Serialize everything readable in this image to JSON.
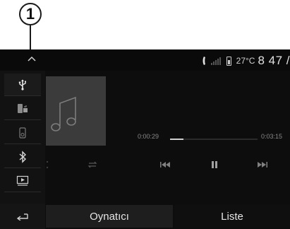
{
  "callout": {
    "number": "1"
  },
  "status": {
    "temperature": "27°C",
    "clock": "8 47 /"
  },
  "sidebar": {
    "items": [
      {
        "name": "usb",
        "active": true
      },
      {
        "name": "phone-media",
        "active": false
      },
      {
        "name": "ipod",
        "active": false
      },
      {
        "name": "bluetooth",
        "active": false
      },
      {
        "name": "aux",
        "active": false
      }
    ]
  },
  "player": {
    "elapsed": "0:00:29",
    "total": "0:03:15",
    "progress_fraction": 0.15
  },
  "tabs": [
    {
      "label": "Oynatıcı",
      "active": true
    },
    {
      "label": "Liste",
      "active": false
    }
  ],
  "colors": {
    "background": "#0d0d0d",
    "text": "#e6e6e6",
    "album": "#3b3b3b"
  }
}
